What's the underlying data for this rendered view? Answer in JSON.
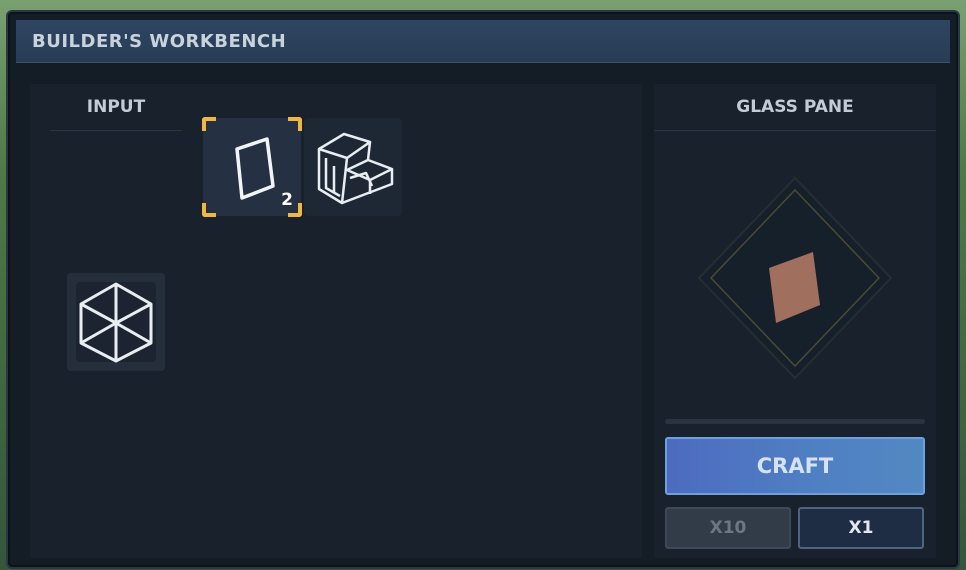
{
  "window": {
    "title": "BUILDER'S WORKBENCH"
  },
  "input_panel": {
    "heading": "INPUT",
    "material_icon": "glass-cube-icon"
  },
  "recipes": [
    {
      "icon": "glass-pane-icon",
      "quantity": "2",
      "selected": true
    },
    {
      "icon": "glass-stairs-icon",
      "quantity": "",
      "selected": false
    }
  ],
  "result_panel": {
    "heading": "GLASS PANE",
    "preview_icon": "glass-pane-preview-icon",
    "progress": 0,
    "craft_label": "CRAFT",
    "amount_options": [
      "X10",
      "X1"
    ],
    "selected_amount": "X1"
  },
  "colors": {
    "selection_accent": "#f0b840",
    "craft_button": "#4f7fc3",
    "pane_color": "#a06f5d"
  }
}
